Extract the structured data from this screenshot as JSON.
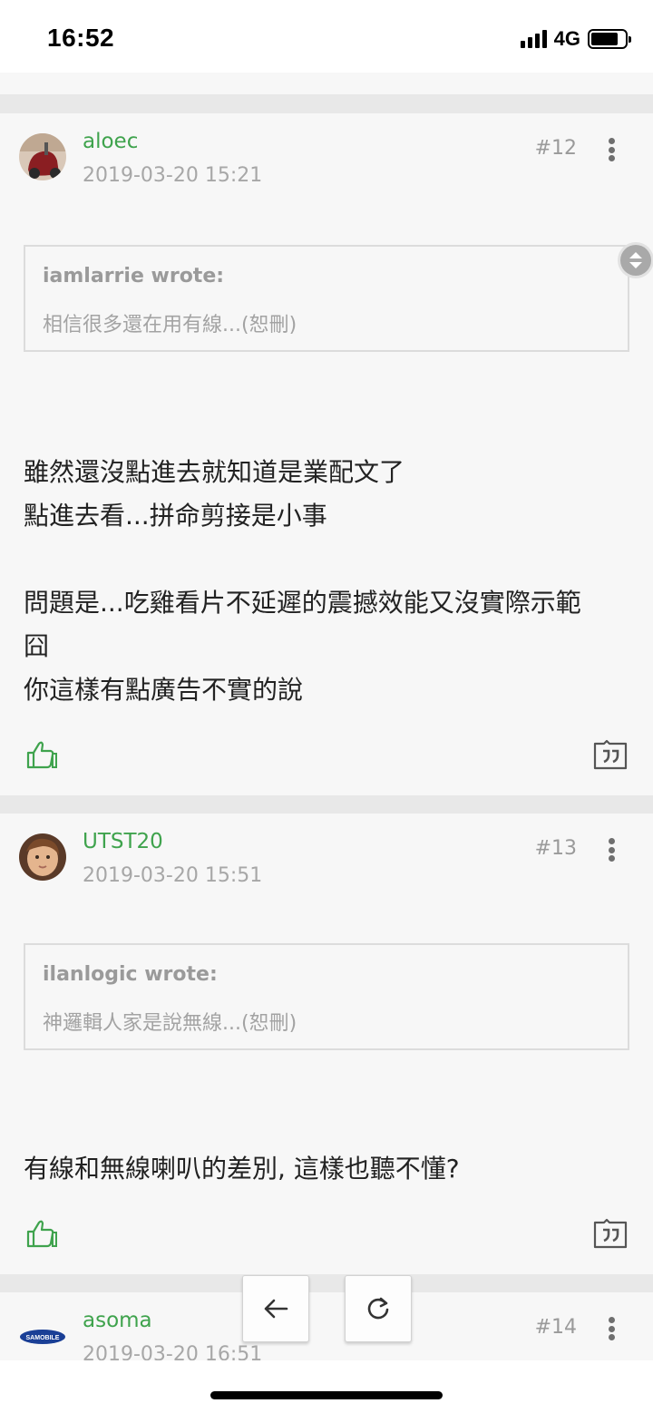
{
  "status_bar": {
    "time": "16:52",
    "network": "4G"
  },
  "posts": [
    {
      "username": "aloec",
      "timestamp": "2019-03-20 15:21",
      "floor": "#12",
      "quote": {
        "author": "iamlarrie wrote:",
        "text": "相信很多還在用有線...(恕刪)"
      },
      "content": "雖然還沒點進去就知道是業配文了\n點進去看...拼命剪接是小事\n\n問題是...吃雞看片不延遲的震撼效能又沒實際示範\n囧\n你這樣有點廣告不實的說"
    },
    {
      "username": "UTST20",
      "timestamp": "2019-03-20 15:51",
      "floor": "#13",
      "quote": {
        "author": "ilanlogic wrote:",
        "text": "神邏輯人家是說無線...(恕刪)"
      },
      "content": "有線和無線喇叭的差別, 這樣也聽不懂?"
    },
    {
      "username": "asoma",
      "timestamp": "2019-03-20 16:51",
      "floor": "#14",
      "avatar_text": "SAMOBILE"
    }
  ],
  "icons": {
    "like": "thumbs-up-icon",
    "reply": "quote-reply-icon",
    "more": "more-vertical-icon",
    "back": "arrow-left-icon",
    "refresh": "refresh-icon"
  },
  "colors": {
    "username": "#3fa34d",
    "accent": "#3fa34d",
    "meta": "#a7a7a7"
  }
}
